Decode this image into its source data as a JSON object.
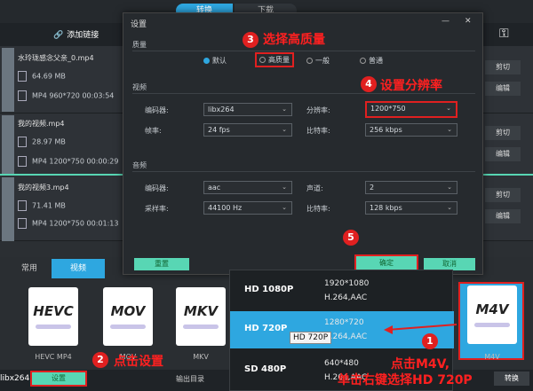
{
  "top_tabs": {
    "convert": "转换",
    "download": "下载"
  },
  "add_link_label": "添加链接",
  "files": [
    {
      "name": "水玲珑感念父亲_0.mp4",
      "size": "64.69 MB",
      "info": "MP4 960*720 00:03:54"
    },
    {
      "name": "我的视频.mp4",
      "size": "28.97 MB",
      "info": "MP4 1200*750 00:00:29"
    },
    {
      "name": "我的视频3.mp4",
      "size": "71.41 MB",
      "info": "MP4 1200*750 00:01:13"
    }
  ],
  "row_buttons": {
    "cut": "剪切",
    "edit": "编辑"
  },
  "dialog": {
    "title": "设置",
    "section_quality": "质量",
    "quality_options": [
      "默认",
      "高质量",
      "一般",
      "普通"
    ],
    "quality_selected": "默认",
    "section_video": "视频",
    "video": {
      "encoder_label": "编码器:",
      "encoder_value": "libx264",
      "resolution_label": "分辨率:",
      "resolution_value": "1200*750",
      "framerate_label": "帧率:",
      "framerate_value": "24 fps",
      "bitrate_label": "比特率:",
      "bitrate_value": "256 kbps"
    },
    "section_audio": "音频",
    "audio": {
      "encoder_label": "编码器:",
      "encoder_value": "aac",
      "channel_label": "声道:",
      "channel_value": "2",
      "samplerate_label": "采样率:",
      "samplerate_value": "44100 Hz",
      "bitrate_label": "比特率:",
      "bitrate_value": "128 kbps"
    },
    "reset": "重置",
    "ok": "确定",
    "cancel": "取消"
  },
  "bottom_tabs": {
    "common": "常用",
    "video": "视频"
  },
  "formats": [
    {
      "label": "HEVC",
      "caption": "HEVC MP4"
    },
    {
      "label": "MOV",
      "caption": "MOV"
    },
    {
      "label": "MKV",
      "caption": "MKV"
    },
    {
      "label": "M4V",
      "caption": "M4V"
    }
  ],
  "status": {
    "codec": "libx264",
    "settings": "设置",
    "output_dir": "输出目录",
    "convert": "转换"
  },
  "menu": [
    {
      "quality": "HD 1080P",
      "res": "1920*1080",
      "codec": "H.264,AAC"
    },
    {
      "quality": "HD 720P",
      "res": "1280*720",
      "codec": "H.264,AAC"
    },
    {
      "quality": "SD 480P",
      "res": "640*480",
      "codec": "H.264,AAC"
    }
  ],
  "tooltip": "HD 720P",
  "annotations": {
    "step1_num": "1",
    "step1_line1": "点击M4V,",
    "step1_line2": "单击右键选择HD 720P",
    "step2_num": "2",
    "step2_text": "点击设置",
    "step3_num": "3",
    "step3_text": "选择高质量",
    "step4_num": "4",
    "step4_text": "设置分辨率",
    "step5_num": "5"
  },
  "colors": {
    "accent": "#2ea7e0",
    "green_button": "#58d6b4",
    "annotation_red": "#e02020"
  }
}
